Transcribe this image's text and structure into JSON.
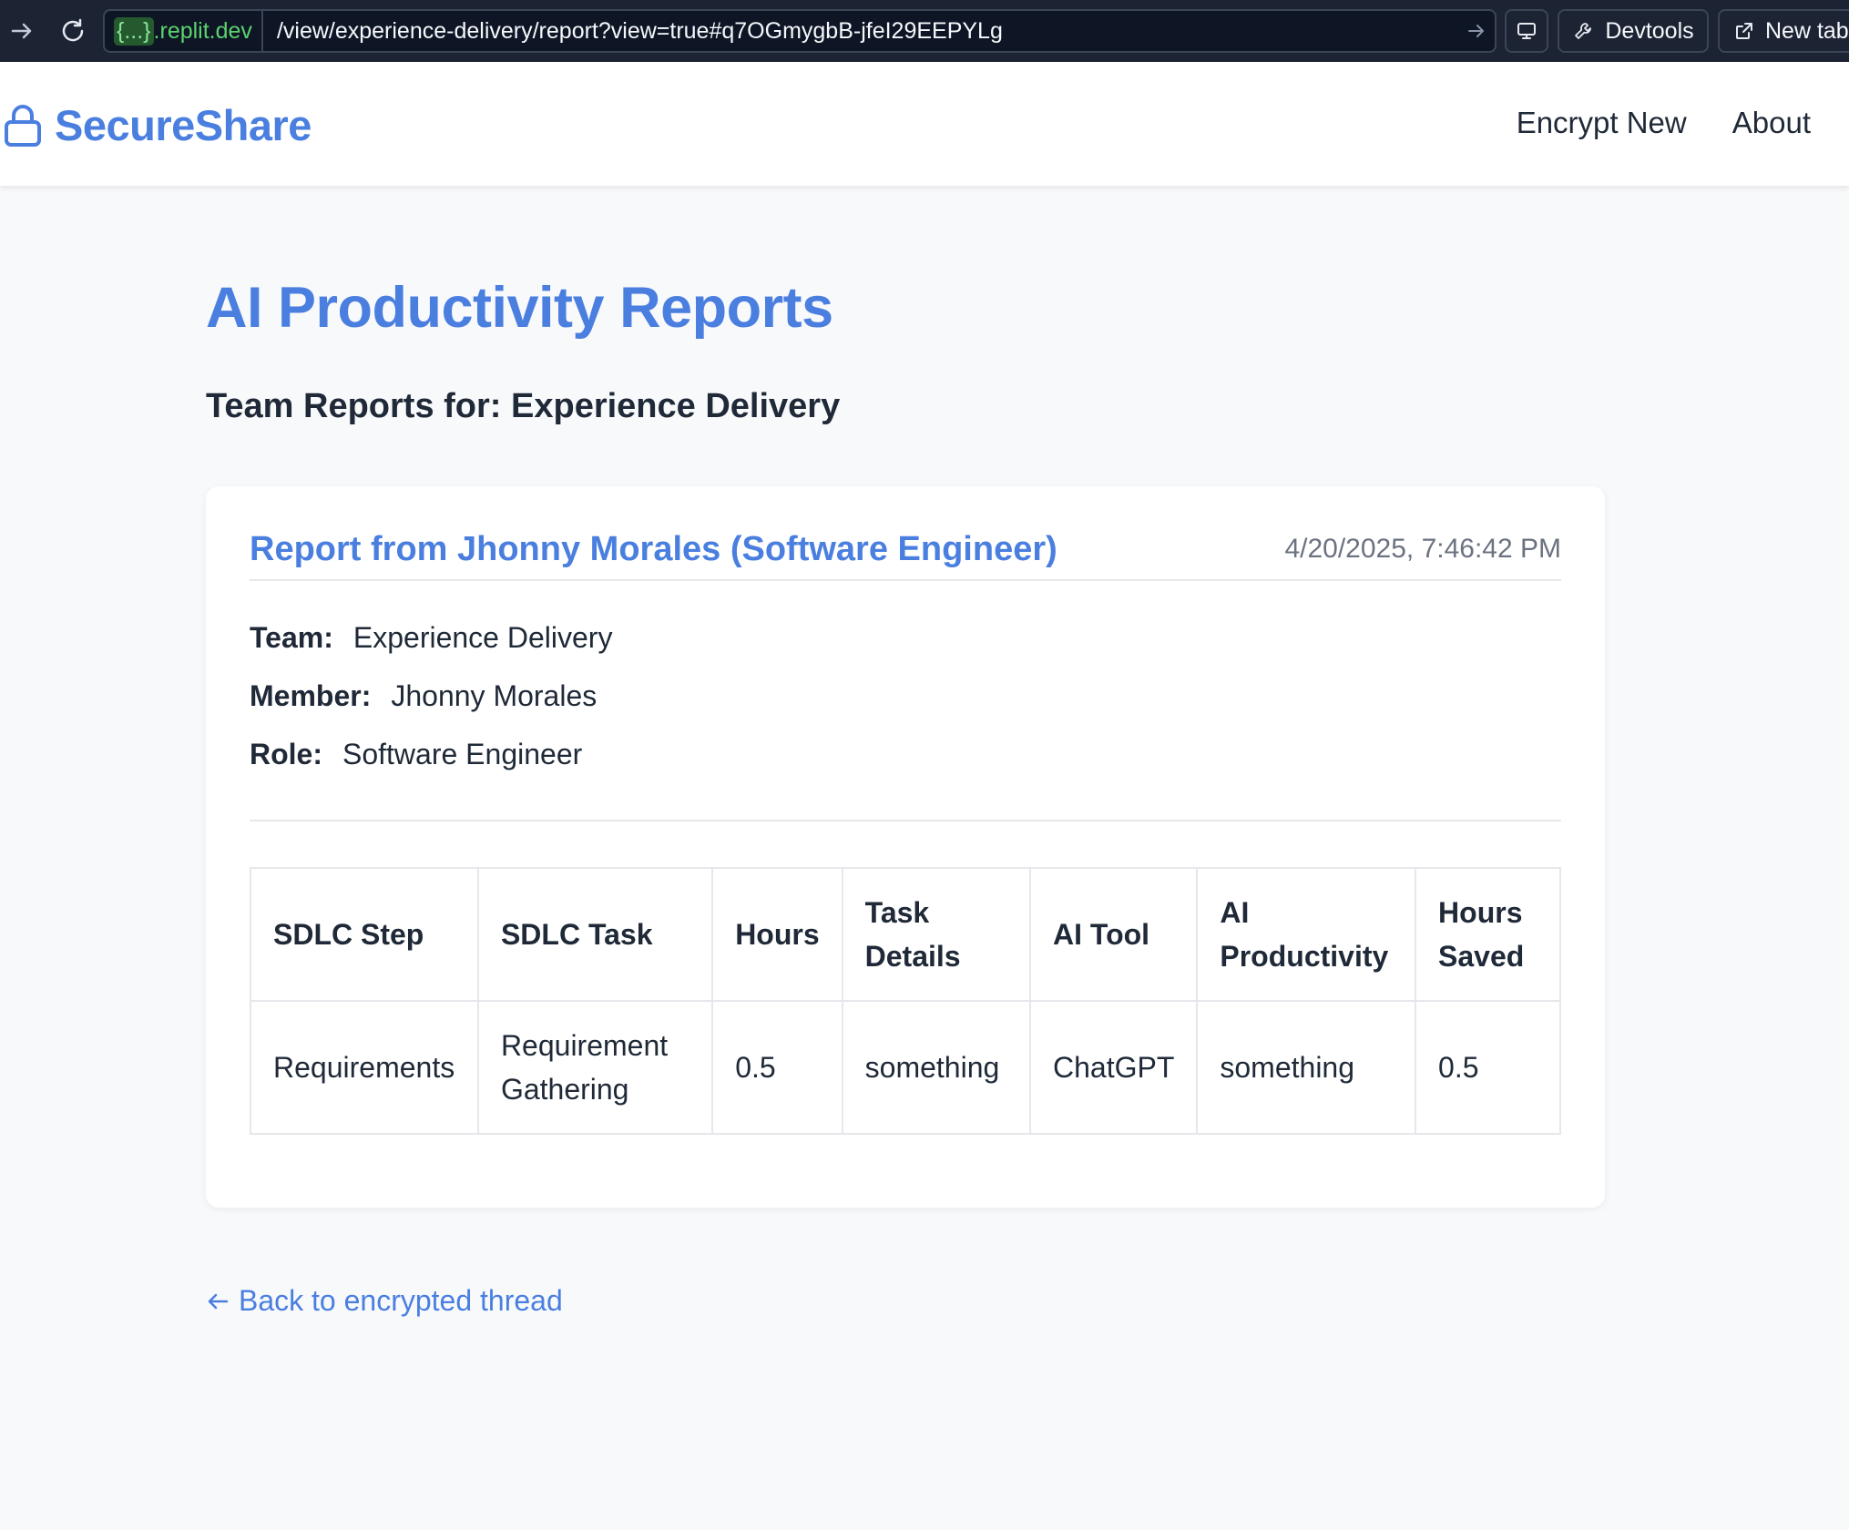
{
  "browser": {
    "host_brace": "{...}",
    "host_rest": ".replit.dev",
    "path": "/view/experience-delivery/report?view=true#q7OGmygbB-jfeI29EEPYLg",
    "devtools_label": "Devtools",
    "newtab_label": "New tab"
  },
  "header": {
    "brand": "SecureShare",
    "nav": [
      "Encrypt New",
      "About"
    ]
  },
  "main": {
    "title": "AI Productivity Reports",
    "subtitle": "Team Reports for: Experience Delivery"
  },
  "report": {
    "title": "Report from Jhonny Morales (Software Engineer)",
    "date": "4/20/2025, 7:46:42 PM",
    "team_label": "Team:",
    "team_value": "Experience Delivery",
    "member_label": "Member:",
    "member_value": "Jhonny Morales",
    "role_label": "Role:",
    "role_value": "Software Engineer"
  },
  "table": {
    "headers": [
      "SDLC Step",
      "SDLC Task",
      "Hours",
      "Task Details",
      "AI Tool",
      "AI Productivity",
      "Hours Saved"
    ],
    "rows": [
      [
        "Requirements",
        "Requirement Gathering",
        "0.5",
        "something",
        "ChatGPT",
        "something",
        "0.5"
      ]
    ]
  },
  "back_link": "Back to encrypted thread",
  "colors": {
    "accent": "#4a7fe0",
    "topbar": "#1c2333",
    "page_bg": "#f8f9fb"
  }
}
